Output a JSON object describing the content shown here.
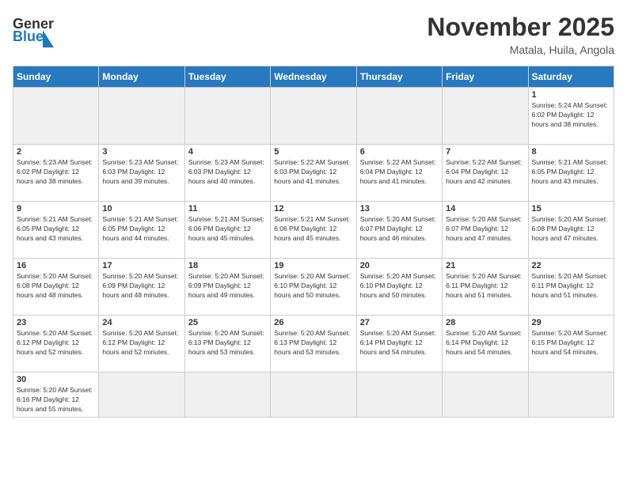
{
  "header": {
    "logo_general": "General",
    "logo_blue": "Blue",
    "month_title": "November 2025",
    "location": "Matala, Huila, Angola"
  },
  "days_of_week": [
    "Sunday",
    "Monday",
    "Tuesday",
    "Wednesday",
    "Thursday",
    "Friday",
    "Saturday"
  ],
  "weeks": [
    [
      {
        "day": "",
        "info": "",
        "empty": true
      },
      {
        "day": "",
        "info": "",
        "empty": true
      },
      {
        "day": "",
        "info": "",
        "empty": true
      },
      {
        "day": "",
        "info": "",
        "empty": true
      },
      {
        "day": "",
        "info": "",
        "empty": true
      },
      {
        "day": "",
        "info": "",
        "empty": true
      },
      {
        "day": "1",
        "info": "Sunrise: 5:24 AM\nSunset: 6:02 PM\nDaylight: 12 hours and 38 minutes."
      }
    ],
    [
      {
        "day": "2",
        "info": "Sunrise: 5:23 AM\nSunset: 6:02 PM\nDaylight: 12 hours and 38 minutes."
      },
      {
        "day": "3",
        "info": "Sunrise: 5:23 AM\nSunset: 6:03 PM\nDaylight: 12 hours and 39 minutes."
      },
      {
        "day": "4",
        "info": "Sunrise: 5:23 AM\nSunset: 6:03 PM\nDaylight: 12 hours and 40 minutes."
      },
      {
        "day": "5",
        "info": "Sunrise: 5:22 AM\nSunset: 6:03 PM\nDaylight: 12 hours and 41 minutes."
      },
      {
        "day": "6",
        "info": "Sunrise: 5:22 AM\nSunset: 6:04 PM\nDaylight: 12 hours and 41 minutes."
      },
      {
        "day": "7",
        "info": "Sunrise: 5:22 AM\nSunset: 6:04 PM\nDaylight: 12 hours and 42 minutes."
      },
      {
        "day": "8",
        "info": "Sunrise: 5:21 AM\nSunset: 6:05 PM\nDaylight: 12 hours and 43 minutes."
      }
    ],
    [
      {
        "day": "9",
        "info": "Sunrise: 5:21 AM\nSunset: 6:05 PM\nDaylight: 12 hours and 43 minutes."
      },
      {
        "day": "10",
        "info": "Sunrise: 5:21 AM\nSunset: 6:05 PM\nDaylight: 12 hours and 44 minutes."
      },
      {
        "day": "11",
        "info": "Sunrise: 5:21 AM\nSunset: 6:06 PM\nDaylight: 12 hours and 45 minutes."
      },
      {
        "day": "12",
        "info": "Sunrise: 5:21 AM\nSunset: 6:06 PM\nDaylight: 12 hours and 45 minutes."
      },
      {
        "day": "13",
        "info": "Sunrise: 5:20 AM\nSunset: 6:07 PM\nDaylight: 12 hours and 46 minutes."
      },
      {
        "day": "14",
        "info": "Sunrise: 5:20 AM\nSunset: 6:07 PM\nDaylight: 12 hours and 47 minutes."
      },
      {
        "day": "15",
        "info": "Sunrise: 5:20 AM\nSunset: 6:08 PM\nDaylight: 12 hours and 47 minutes."
      }
    ],
    [
      {
        "day": "16",
        "info": "Sunrise: 5:20 AM\nSunset: 6:08 PM\nDaylight: 12 hours and 48 minutes."
      },
      {
        "day": "17",
        "info": "Sunrise: 5:20 AM\nSunset: 6:09 PM\nDaylight: 12 hours and 48 minutes."
      },
      {
        "day": "18",
        "info": "Sunrise: 5:20 AM\nSunset: 6:09 PM\nDaylight: 12 hours and 49 minutes."
      },
      {
        "day": "19",
        "info": "Sunrise: 5:20 AM\nSunset: 6:10 PM\nDaylight: 12 hours and 50 minutes."
      },
      {
        "day": "20",
        "info": "Sunrise: 5:20 AM\nSunset: 6:10 PM\nDaylight: 12 hours and 50 minutes."
      },
      {
        "day": "21",
        "info": "Sunrise: 5:20 AM\nSunset: 6:11 PM\nDaylight: 12 hours and 51 minutes."
      },
      {
        "day": "22",
        "info": "Sunrise: 5:20 AM\nSunset: 6:11 PM\nDaylight: 12 hours and 51 minutes."
      }
    ],
    [
      {
        "day": "23",
        "info": "Sunrise: 5:20 AM\nSunset: 6:12 PM\nDaylight: 12 hours and 52 minutes."
      },
      {
        "day": "24",
        "info": "Sunrise: 5:20 AM\nSunset: 6:12 PM\nDaylight: 12 hours and 52 minutes."
      },
      {
        "day": "25",
        "info": "Sunrise: 5:20 AM\nSunset: 6:13 PM\nDaylight: 12 hours and 53 minutes."
      },
      {
        "day": "26",
        "info": "Sunrise: 5:20 AM\nSunset: 6:13 PM\nDaylight: 12 hours and 53 minutes."
      },
      {
        "day": "27",
        "info": "Sunrise: 5:20 AM\nSunset: 6:14 PM\nDaylight: 12 hours and 54 minutes."
      },
      {
        "day": "28",
        "info": "Sunrise: 5:20 AM\nSunset: 6:14 PM\nDaylight: 12 hours and 54 minutes."
      },
      {
        "day": "29",
        "info": "Sunrise: 5:20 AM\nSunset: 6:15 PM\nDaylight: 12 hours and 54 minutes."
      }
    ],
    [
      {
        "day": "30",
        "info": "Sunrise: 5:20 AM\nSunset: 6:16 PM\nDaylight: 12 hours and 55 minutes."
      },
      {
        "day": "",
        "info": "",
        "empty": true
      },
      {
        "day": "",
        "info": "",
        "empty": true
      },
      {
        "day": "",
        "info": "",
        "empty": true
      },
      {
        "day": "",
        "info": "",
        "empty": true
      },
      {
        "day": "",
        "info": "",
        "empty": true
      },
      {
        "day": "",
        "info": "",
        "empty": true
      }
    ]
  ]
}
